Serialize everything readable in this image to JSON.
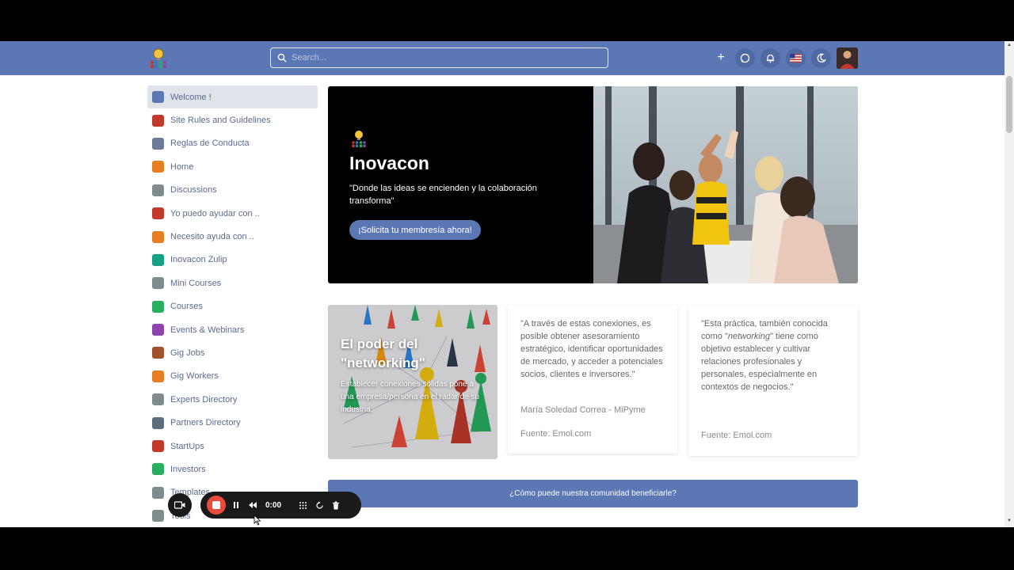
{
  "topbar": {
    "search_placeholder": "Search...",
    "icons": [
      "plus-icon",
      "whatsapp-icon",
      "bell-icon",
      "us-flag-icon",
      "moon-icon"
    ]
  },
  "sidebar": {
    "items": [
      {
        "label": "Welcome !",
        "icon": "welcome-icon",
        "color": "#5b78b4",
        "active": true
      },
      {
        "label": "Site Rules and Guidelines",
        "icon": "rules-icon",
        "color": "#c0392b"
      },
      {
        "label": "Reglas de Conducta",
        "icon": "conduct-icon",
        "color": "#6b7a99"
      },
      {
        "label": "Home",
        "icon": "home-icon",
        "color": "#e67e22"
      },
      {
        "label": "Discussions",
        "icon": "discussions-icon",
        "color": "#7f8c8d"
      },
      {
        "label": "Yo puedo ayudar con ..",
        "icon": "help-offer-icon",
        "color": "#c0392b"
      },
      {
        "label": "Necesito ayuda con ..",
        "icon": "help-need-icon",
        "color": "#e67e22"
      },
      {
        "label": "Inovacon Zulip",
        "icon": "zulip-icon",
        "color": "#16a085"
      },
      {
        "label": "Mini Courses",
        "icon": "mini-courses-icon",
        "color": "#7f8c8d"
      },
      {
        "label": "Courses",
        "icon": "courses-icon",
        "color": "#27ae60"
      },
      {
        "label": "Events & Webinars",
        "icon": "events-icon",
        "color": "#8e44ad"
      },
      {
        "label": "Gig Jobs",
        "icon": "gig-jobs-icon",
        "color": "#a0522d"
      },
      {
        "label": "Gig Workers",
        "icon": "gig-workers-icon",
        "color": "#e67e22"
      },
      {
        "label": "Experts Directory",
        "icon": "experts-icon",
        "color": "#7f8c8d"
      },
      {
        "label": "Partners Directory",
        "icon": "partners-icon",
        "color": "#5d6d7e"
      },
      {
        "label": "StartUps",
        "icon": "startups-icon",
        "color": "#c0392b"
      },
      {
        "label": "Investors",
        "icon": "investors-icon",
        "color": "#27ae60"
      },
      {
        "label": "Templates",
        "icon": "templates-icon",
        "color": "#7f8c8d"
      },
      {
        "label": "Tools",
        "icon": "tools-icon",
        "color": "#7f8c8d"
      }
    ]
  },
  "hero": {
    "title": "Inovacon",
    "subtitle": "\"Donde las ideas se encienden y la colaboración transforma\"",
    "button": "¡Solicita tu membresía ahora!"
  },
  "networking": {
    "title": "El poder del \"networking\"",
    "subtitle": "Establecer conexiones sólidas pone a una empresa/persona en el radar de su industria."
  },
  "quote1": {
    "text": "\"A través de estas conexiones, es posible obtener asesoramiento estratégico, identificar oportunidades de mercado, y acceder a potenciales socios, clientes e inversores.\"",
    "author": "María Soledad Correa - MiPyme",
    "source": "Fuente: Emol.com"
  },
  "quote2": {
    "text_before": "\"Esta práctica, también conocida como \"",
    "text_emph": "networking",
    "text_after": "\" tiene como objetivo establecer y cultivar relaciones profesionales y personales, especialmente en contextos de negocios.\"",
    "source": "Fuente: Emol.com"
  },
  "banner": {
    "label": "¿Cómo puede nuestra comunidad beneficiarle?"
  },
  "recorder": {
    "time": "0:00"
  },
  "colors": {
    "accent": "#5b78b4",
    "recording": "#e74c3c"
  }
}
